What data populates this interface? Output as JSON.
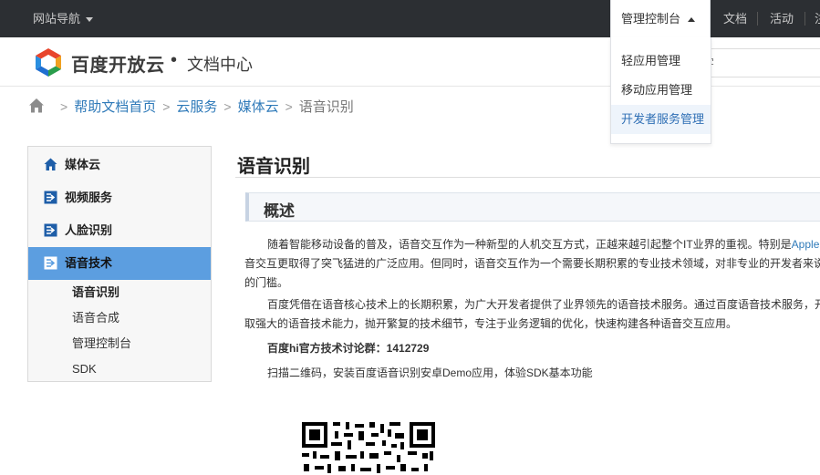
{
  "topbar": {
    "site_nav": "网站导航",
    "console": "管理控制台",
    "links": [
      "文档",
      "活动",
      "注"
    ]
  },
  "header": {
    "brand": "百度开放云",
    "dot": "•",
    "subtitle": "文档中心",
    "search_placeholder": "键字"
  },
  "dropdown": {
    "items": [
      "轻应用管理",
      "移动应用管理",
      "开发者服务管理"
    ],
    "active_index": 2
  },
  "breadcrumb": {
    "items": [
      "帮助文档首页",
      "云服务",
      "媒体云"
    ],
    "current": "语音识别"
  },
  "sidebar": {
    "items": [
      {
        "label": "媒体云",
        "icon": "home-icon"
      },
      {
        "label": "视频服务",
        "icon": "arrow-right-box-icon"
      },
      {
        "label": "人脸识别",
        "icon": "arrow-right-box-icon"
      },
      {
        "label": "语音技术",
        "icon": "arrow-right-box-icon"
      }
    ],
    "active_index": 3,
    "sub_items": [
      "语音识别",
      "语音合成",
      "管理控制台",
      "SDK"
    ],
    "current_sub": 0
  },
  "main": {
    "title": "语音识别",
    "section": "概述",
    "p1_lines": [
      "随着智能移动设备的普及，语音交互作为一种新型的人机交互方式，正越来越引起整个IT业界的重视。特别是",
      "音交互更取得了突飞猛进的广泛应用。但同时，语音交互作为一个需要长期积累的专业技术领域，对非专业的开发者来说",
      "的门槛。"
    ],
    "p1_highlight": "Apple",
    "p2_lines": [
      "百度凭借在语音核心技术上的长期积累，为广大开发者提供了业界领先的语音技术服务。通过百度语音技术服务，开",
      "取强大的语音技术能力，抛开繁复的技术细节，专注于业务逻辑的优化，快速构建各种语音交互应用。"
    ],
    "qq_group_label": "百度hi官方技术讨论群：",
    "qq_group_number": "1412729",
    "scan_text": "扫描二维码，安装百度语音识别安卓Demo应用，体验SDK基本功能"
  },
  "colors": {
    "topbar_bg": "#2c2f33",
    "link_blue": "#2f7ab9",
    "sidebar_active": "#5c9ee0"
  }
}
